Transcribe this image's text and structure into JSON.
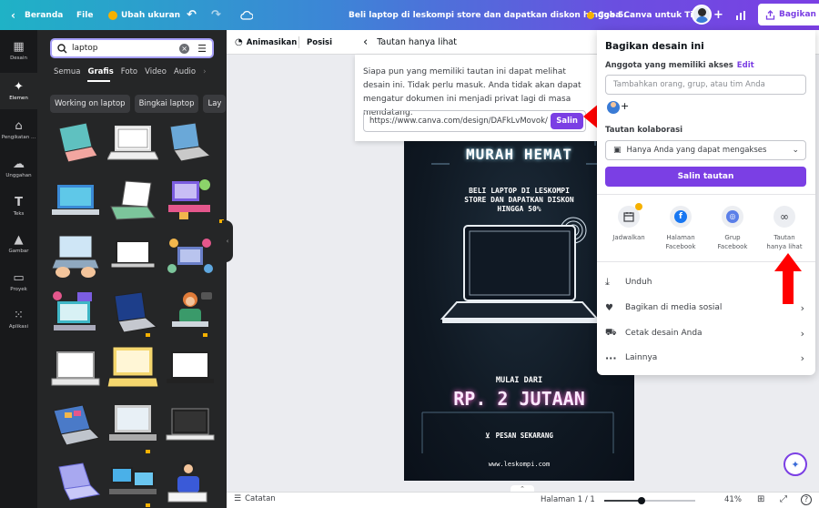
{
  "topbar": {
    "home_label": "Beranda",
    "file_label": "File",
    "resize_label": "Ubah ukuran",
    "doc_title": "Beli laptop di leskompi store dan dapatkan diskon hingga 5...",
    "try_team_label": "Coba Canva untuk Tim",
    "share_label": "Bagikan"
  },
  "rail": {
    "items": [
      {
        "label": "Desain",
        "icon": "layout-icon"
      },
      {
        "label": "Elemen",
        "icon": "elements-icon"
      },
      {
        "label": "Pengikatan ...",
        "icon": "brand-icon"
      },
      {
        "label": "Unggahan",
        "icon": "upload-icon"
      },
      {
        "label": "Teks",
        "icon": "text-icon"
      },
      {
        "label": "Gambar",
        "icon": "image-icon"
      },
      {
        "label": "Proyek",
        "icon": "folder-icon"
      },
      {
        "label": "Aplikasi",
        "icon": "apps-icon"
      }
    ]
  },
  "panel": {
    "search_value": "laptop",
    "tabs": [
      "Semua",
      "Grafis",
      "Foto",
      "Video",
      "Audio"
    ],
    "active_tab": "Grafis",
    "chips": [
      "Working on laptop",
      "Bingkai laptop",
      "Lay"
    ]
  },
  "toolbar": {
    "animate_label": "Animasikan",
    "position_label": "Posisi"
  },
  "link_dialog": {
    "title": "Tautan hanya lihat",
    "description": "Siapa pun yang memiliki tautan ini dapat melihat desain ini. Tidak perlu masuk. Anda tidak akan dapat mengatur dokumen ini menjadi privat lagi di masa mendatang.",
    "url": "https://www.canva.com/design/DAFkLvMovok/",
    "copy_label": "Salin"
  },
  "share_panel": {
    "title": "Bagikan desain ini",
    "members_label": "Anggota yang memiliki akses",
    "edit_label": "Edit",
    "add_placeholder": "Tambahkan orang, grup, atau tim Anda",
    "collab_label": "Tautan kolaborasi",
    "access_value": "Hanya Anda yang dapat mengakses",
    "copy_link_label": "Salin tautan",
    "options": [
      {
        "label": "Jadwalkan",
        "icon": "calendar-icon"
      },
      {
        "label": "Halaman Facebook",
        "icon": "facebook-icon"
      },
      {
        "label": "Grup Facebook",
        "icon": "facebook-group-icon"
      },
      {
        "label": "Tautan hanya lihat",
        "icon": "link-icon"
      }
    ],
    "rows": [
      {
        "label": "Unduh",
        "icon": "download-icon"
      },
      {
        "label": "Bagikan di media sosial",
        "icon": "heart-icon"
      },
      {
        "label": "Cetak desain Anda",
        "icon": "truck-icon"
      },
      {
        "label": "Lainnya",
        "icon": "more-icon"
      }
    ]
  },
  "poster": {
    "headline": "MURAH HEMAT",
    "sub1": "BELI LAPTOP DI LESKOMPI",
    "sub2": "STORE DAN DAPATKAN DISKON",
    "sub3": "HINGGA 50%",
    "from_label": "MULAI DARI",
    "price": "RP. 2 JUTAAN",
    "order_label": "PESAN SEKARANG",
    "website": "www.leskompi.com"
  },
  "bottombar": {
    "notes_label": "Catatan",
    "page_label": "Halaman 1 / 1",
    "zoom_label": "41%",
    "zoom_fraction": 0.41
  },
  "colors": {
    "accent": "#7b3fe4",
    "arrow_red": "#ff0000"
  }
}
